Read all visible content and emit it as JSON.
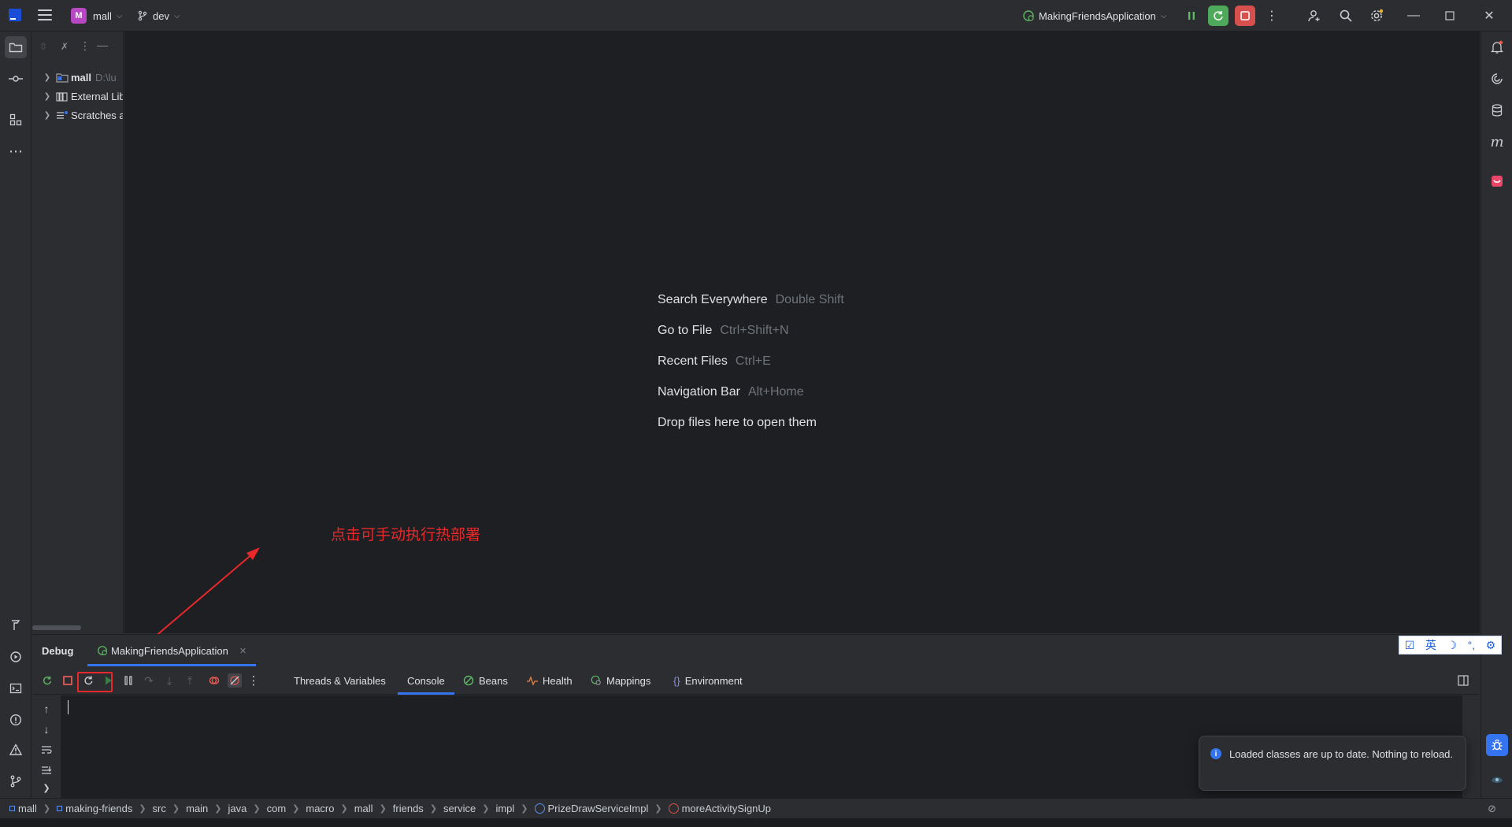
{
  "titlebar": {
    "project_initial": "M",
    "project_name": "mall",
    "branch": "dev",
    "run_config": "MakingFriendsApplication"
  },
  "project_tree": {
    "items": [
      {
        "label": "mall",
        "hint": "D:\\lu"
      },
      {
        "label": "External Lib",
        "hint": ""
      },
      {
        "label": "Scratches a",
        "hint": ""
      }
    ]
  },
  "editor": {
    "hints": [
      {
        "action": "Search Everywhere",
        "key": "Double Shift"
      },
      {
        "action": "Go to File",
        "key": "Ctrl+Shift+N"
      },
      {
        "action": "Recent Files",
        "key": "Ctrl+E"
      },
      {
        "action": "Navigation Bar",
        "key": "Alt+Home"
      },
      {
        "action": "Drop files here to open them",
        "key": ""
      }
    ],
    "annotation": "点击可手动执行热部署"
  },
  "debug": {
    "title": "Debug",
    "session": "MakingFriendsApplication",
    "tabs": [
      "Threads & Variables",
      "Console",
      "Beans",
      "Health",
      "Mappings",
      "Environment"
    ],
    "active_tab": "Console"
  },
  "notification": {
    "message": "Loaded classes are up to date. Nothing to reload."
  },
  "ime": {
    "lang": "英"
  },
  "breadcrumbs": [
    "mall",
    "making-friends",
    "src",
    "main",
    "java",
    "com",
    "macro",
    "mall",
    "friends",
    "service",
    "impl",
    "PrizeDrawServiceImpl",
    "moreActivitySignUp"
  ],
  "colors": {
    "accent": "#3574f0",
    "annotation_red": "#e8282b",
    "run_green": "#4ea95b",
    "stop_red": "#d8504d"
  }
}
